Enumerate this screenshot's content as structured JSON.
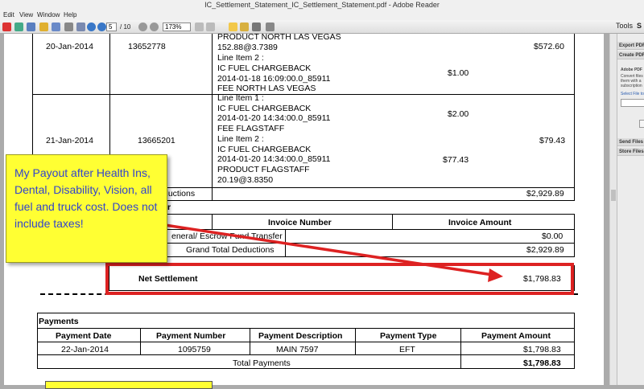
{
  "window": {
    "title": "IC_Settlement_Statement_IC_Settlement_Statement.pdf - Adobe Reader"
  },
  "menu": [
    "Edit",
    "View",
    "Window",
    "Help"
  ],
  "toolbar": {
    "page_current": "5",
    "page_total": "/ 10",
    "zoom": "173%",
    "tools_label": "Tools",
    "s_label": "S"
  },
  "panel": {
    "export": "Export PDF",
    "create": "Create PDF",
    "adobe": "Adobe PDF",
    "desc1": "Convert files",
    "desc2": "them with a",
    "desc3": "subscription",
    "select": "Select File to",
    "send": "Send Files",
    "store": "Store Files"
  },
  "rows": [
    {
      "date": "20-Jan-2014",
      "invoice": "13652778",
      "lines": [
        "PRODUCT NORTH LAS VEGAS",
        "152.88@3.7389",
        "Line Item 2 :",
        "IC FUEL CHARGEBACK",
        "2014-01-18 16:09:00.0_85911",
        "FEE NORTH LAS VEGAS"
      ],
      "line_amount": "$1.00",
      "total": "$572.60"
    },
    {
      "date": "21-Jan-2014",
      "invoice": "13665201",
      "lines": [
        "Line Item 1 :",
        "IC FUEL CHARGEBACK",
        "2014-01-20 14:34:00.0_85911",
        "FEE FLAGSTAFF",
        "Line Item 2 :",
        "IC FUEL CHARGEBACK",
        "2014-01-20 14:34:00.0_85911",
        "PRODUCT FLAGSTAFF",
        "20.19@3.8350"
      ],
      "line_amount_1": "$2.00",
      "line_amount_2": "$77.43",
      "total": "$79.43"
    }
  ],
  "deductions": {
    "label_partial": "ductions",
    "amount": "$2,929.89"
  },
  "summary": {
    "section_partial": "r",
    "col_invoice": "Invoice Number",
    "col_amount": "Invoice Amount",
    "escrow_label": "eneral/ Escrow Fund Transfer",
    "escrow_amount": "$0.00",
    "grand_label": "Grand Total Deductions",
    "grand_amount": "$2,929.89"
  },
  "net": {
    "label": "Net Settlement",
    "amount": "$1,798.83"
  },
  "payments": {
    "title": "Payments",
    "headers": [
      "Payment  Date",
      "Payment  Number",
      "Payment Description",
      "Payment Type",
      "Payment Amount"
    ],
    "row": [
      "22-Jan-2014",
      "1095759",
      "MAIN 7597",
      "EFT",
      "$1,798.83"
    ],
    "total_label": "Total Payments",
    "total_amount": "$1,798.83"
  },
  "annotation": {
    "text": "My Payout after Health Ins, Dental, Disability, Vision, all fuel and truck cost. Does not include taxes!"
  },
  "colors": {
    "note_bg": "#ffff33",
    "note_text": "#3344cc",
    "arrow": "#dd2222"
  }
}
